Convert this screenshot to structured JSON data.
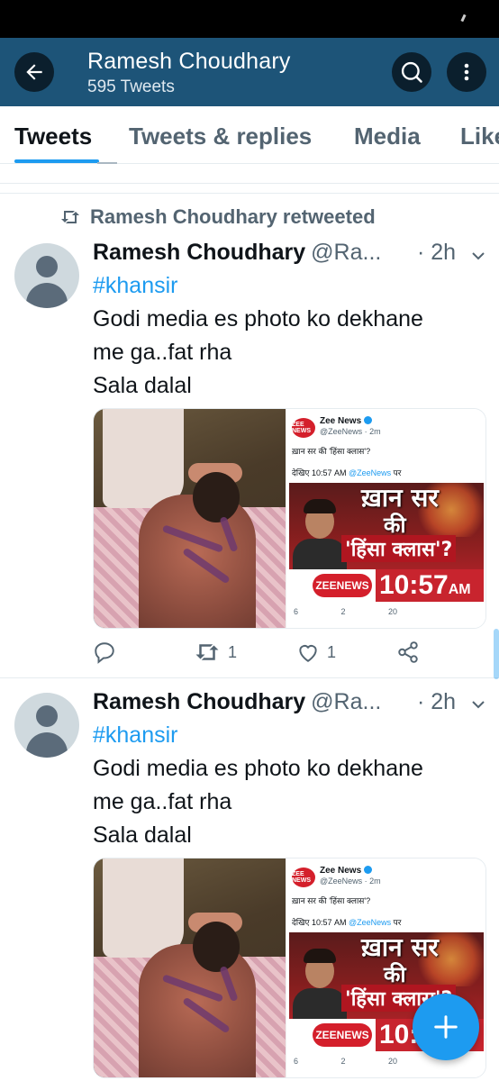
{
  "header": {
    "title": "Ramesh Choudhary",
    "subtitle": "595 Tweets"
  },
  "tabs": [
    {
      "label": "Tweets",
      "active": true
    },
    {
      "label": "Tweets & replies"
    },
    {
      "label": "Media"
    },
    {
      "label": "Likes"
    }
  ],
  "retweet_notice": "Ramesh Choudhary retweeted",
  "tweets": [
    {
      "name": "Ramesh Choudhary",
      "handle": "@Ra...",
      "time": "· 2h",
      "hashtag": "#khansir",
      "lines": [
        "Godi media es photo ko dekhane",
        "me ga..fat rha",
        "Sala dalal"
      ],
      "reply_count": "",
      "retweet_count": "1",
      "like_count": "1"
    },
    {
      "name": "Ramesh Choudhary",
      "handle": "@Ra...",
      "time": "· 2h",
      "hashtag": "#khansir",
      "lines": [
        "Godi media es photo ko dekhane",
        "me ga..fat rha",
        "Sala dalal"
      ]
    }
  ],
  "embedded": {
    "logo_text": "ZEE NEWS",
    "source_name": "Zee News",
    "source_meta": "@ZeeNews · 2m",
    "line1": "ख़ान सर की 'हिंसा क्लास'?",
    "line2_prefix": "देखिए 10:57 AM",
    "line2_link": "@ZeeNews",
    "line2_suffix": "पर",
    "headline_1": "ख़ान सर",
    "headline_2": "की",
    "headline_3": "'हिंसा क्लास'?",
    "brand": "ZEENEWS",
    "clock": "10:57",
    "clock_suffix": "AM",
    "replies": "6",
    "retweets": "2",
    "likes": "20"
  },
  "icons": {
    "back": "arrow-left-icon",
    "search": "search-icon",
    "more": "more-vertical-icon",
    "retweet": "retweet-icon",
    "reply": "reply-icon",
    "like": "heart-icon",
    "share": "share-icon",
    "compose": "plus-icon"
  },
  "colors": {
    "accent": "#1d9bf0",
    "header_bg": "#1d5478",
    "text": "#0f1419",
    "muted": "#536471"
  }
}
